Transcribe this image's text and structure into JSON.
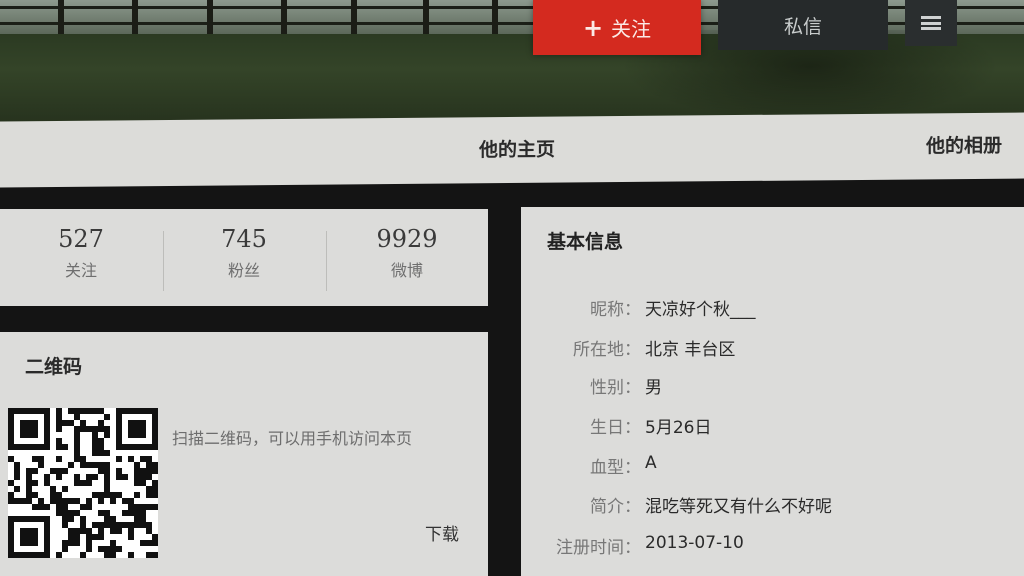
{
  "header": {
    "follow_button": "关注",
    "follow_icon": "+",
    "message_button": "私信",
    "menu_icon": "hamburger-menu-icon"
  },
  "tabs": [
    {
      "label": "他的主页"
    },
    {
      "label": "他的相册"
    }
  ],
  "stats": [
    {
      "value": "527",
      "label": "关注"
    },
    {
      "value": "745",
      "label": "粉丝"
    },
    {
      "value": "9929",
      "label": "微博"
    }
  ],
  "qr": {
    "title": "二维码",
    "description": "扫描二维码，可以用手机访问本页",
    "download": "下载"
  },
  "info": {
    "title": "基本信息",
    "rows": [
      {
        "key": "昵称：",
        "value": "天凉好个秋___"
      },
      {
        "key": "所在地：",
        "value": "北京 丰台区"
      },
      {
        "key": "性别：",
        "value": "男"
      },
      {
        "key": "生日：",
        "value": "5月26日"
      },
      {
        "key": "血型：",
        "value": "A"
      },
      {
        "key": "简介：",
        "value": "混吃等死又有什么不好呢"
      },
      {
        "key": "注册时间：",
        "value": "2013-07-10"
      }
    ]
  },
  "colors": {
    "follow": "#d42a1f",
    "card": "#dcdcda",
    "background": "#141414"
  }
}
